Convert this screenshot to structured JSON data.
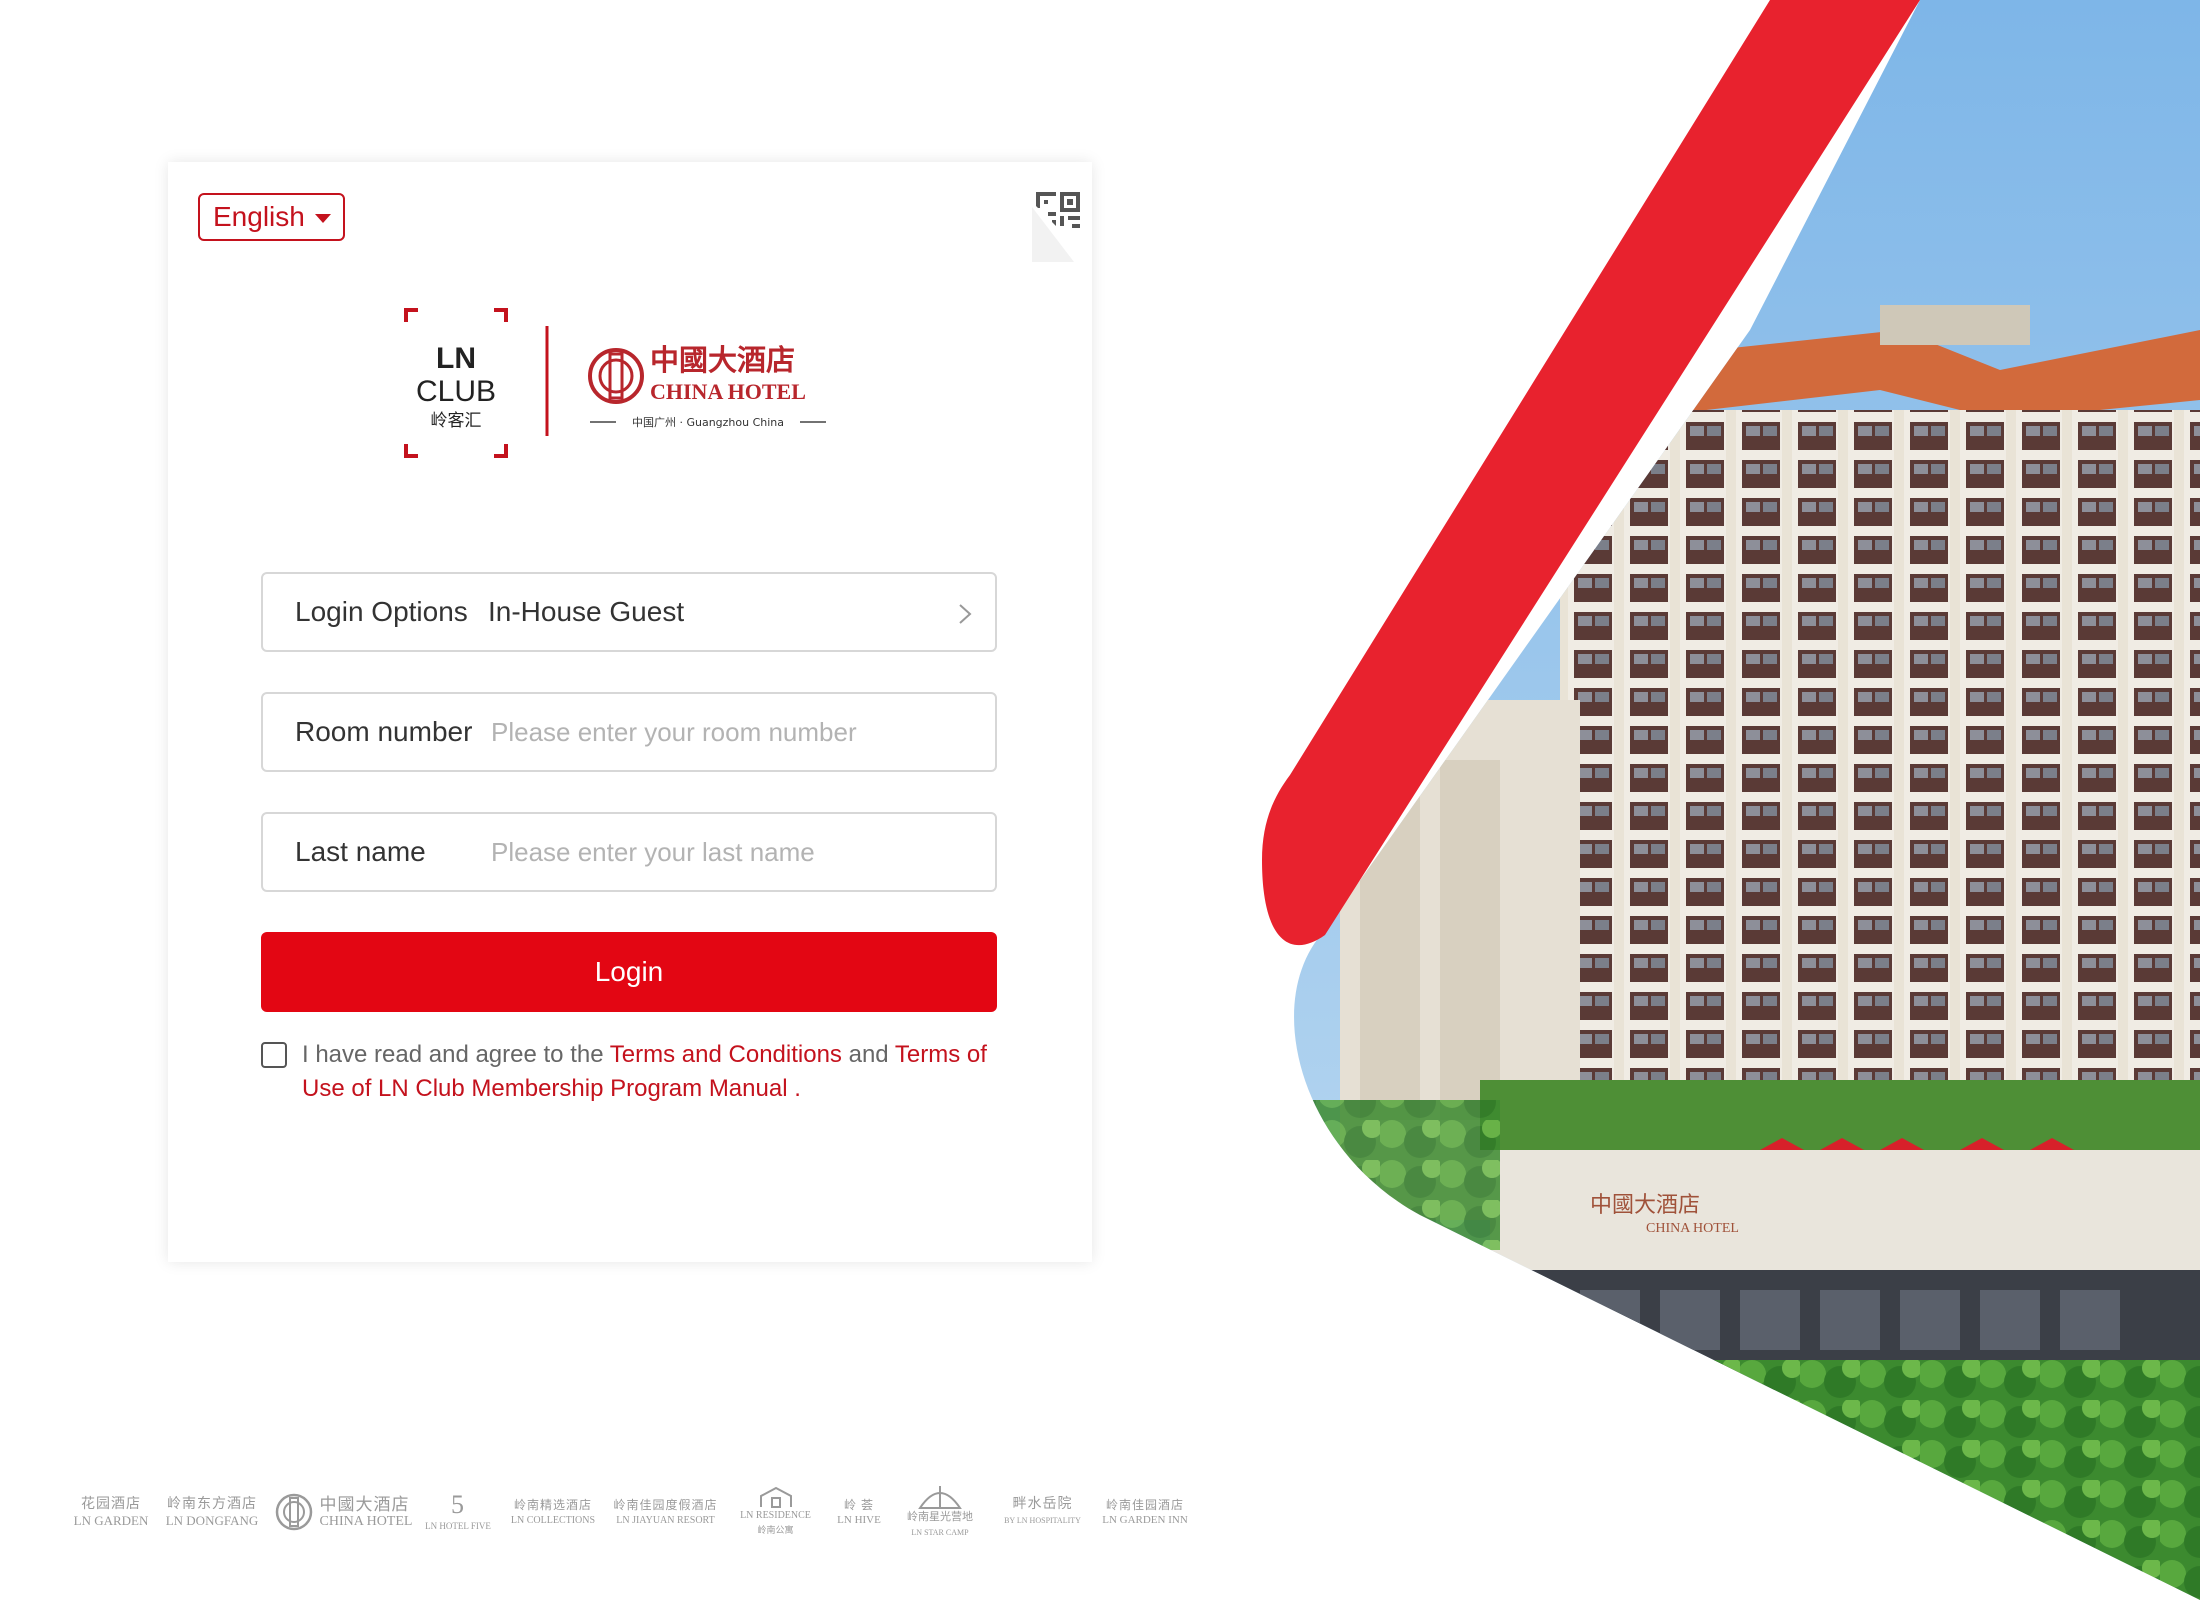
{
  "language": {
    "selected": "English"
  },
  "logo": {
    "club_mark_line1": "LN",
    "club_mark_line2": "CLUB",
    "club_mark_cn": "岭客汇",
    "hotel_name_cn": "中國大酒店",
    "hotel_name_en": "CHINA HOTEL",
    "hotel_location": "中国广州 · Guangzhou China"
  },
  "form": {
    "login_options": {
      "label": "Login Options",
      "value": "In-House Guest"
    },
    "room_number": {
      "label": "Room number",
      "placeholder": "Please enter your room number"
    },
    "last_name": {
      "label": "Last name",
      "placeholder": "Please enter your last name"
    },
    "login_button": "Login"
  },
  "agreement": {
    "prefix": "I have read and agree to the ",
    "terms_link": "Terms and Conditions",
    "middle": " and ",
    "manual_link": "Terms of Use of LN Club Membership Program Manual",
    "suffix": " ."
  },
  "brands": [
    {
      "cn": "花园酒店",
      "en": "LN GARDEN"
    },
    {
      "cn": "岭南东方酒店",
      "en": "LN DONGFANG"
    },
    {
      "cn": "中國大酒店",
      "en": "CHINA HOTEL"
    },
    {
      "cn": "5",
      "en": "LN HOTEL FIVE"
    },
    {
      "cn": "岭南精选酒店",
      "en": "LN COLLECTIONS"
    },
    {
      "cn": "岭南佳园度假酒店",
      "en": "LN JIAYUAN RESORT"
    },
    {
      "cn": "岭南公寓",
      "en": "LN RESIDENCE"
    },
    {
      "cn": "岭 荟",
      "en": "LN HIVE"
    },
    {
      "cn": "岭南星光营地",
      "en": "LN STAR CAMP"
    },
    {
      "cn": "畔水岳院",
      "en": "BY LN HOSPITALITY"
    },
    {
      "cn": "岭南佳园酒店",
      "en": "LN GARDEN INN"
    }
  ],
  "hero": {
    "signage_cn": "中國大酒店",
    "signage_en": "CHINA HOTEL",
    "accent_color": "#e8222e",
    "sky_color": "#8fc3ec"
  }
}
